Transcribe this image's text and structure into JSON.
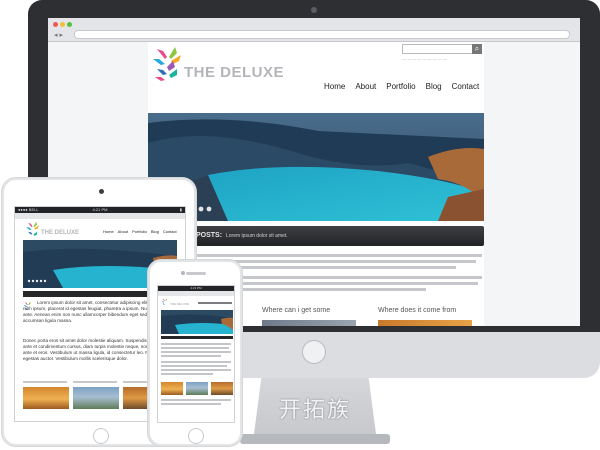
{
  "desktop": {
    "site": {
      "logo_text": "THE DELUXE",
      "nav": [
        "Home",
        "About",
        "Portfolio",
        "Blog",
        "Contact"
      ],
      "posts_label": "POSTS:",
      "posts_text": "Lorem ipsum dolor sit amet.",
      "body_line1": "Lorem ipsum dolor sit amet, consectetur adipiscing elit. Vestibulum nibh ipsum, placerat id egestas feugiat, pharetra a ipsum.",
      "col_where_get": "Where can i get some",
      "col_where_from": "Where does it come from"
    }
  },
  "tablet": {
    "status_carrier": "●●●● BELL",
    "status_time": "4:21 PM",
    "logo_text": "THE DELUXE",
    "nav": [
      "Home",
      "About",
      "Portfolio",
      "Blog",
      "Contact"
    ],
    "para1": "Lorem ipsum dolor sit amet, consectetur adipiscing elit. Vestibulum nibh ipsum, placerat id egestas feugiat, pharetra a ipsum. Nullam eget metus ante. Aenean enim non nunc ullamcorper bibendum eget sed turpis. Integer accumsan ligula massa.",
    "para2": "Donec porta eros sit amet dolor molestie aliquam. Suspendisse hendrerit, ante et condimentum cursus, diam turpis molestie neque, non fringilla diam ante et eros. Vestibulum ut massa ligula, id consectetur leo. Nulla porttitor egestas auctor. Vestibulum mollis scelerisque dolor."
  },
  "phone": {
    "status_time": "4:21 PM",
    "logo_text": "THE DELUXE"
  },
  "watermark": "开拓族"
}
